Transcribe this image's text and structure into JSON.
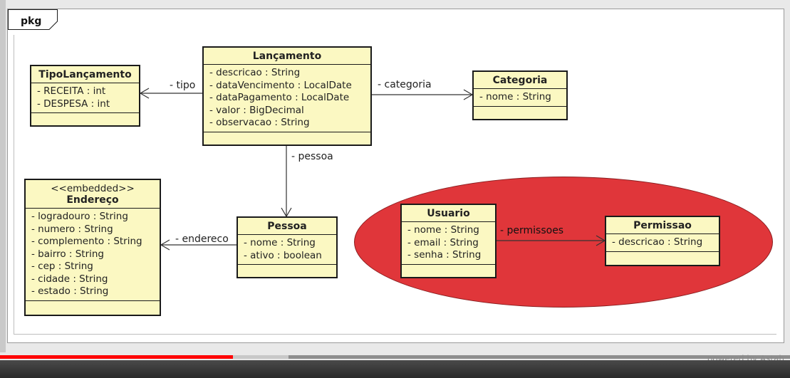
{
  "package": {
    "label": "pkg"
  },
  "classes": {
    "lancamento": {
      "name": "Lançamento",
      "attributes": [
        "- descricao : String",
        "- dataVencimento : LocalDate",
        "- dataPagamento : LocalDate",
        "- valor : BigDecimal",
        "- observacao : String"
      ]
    },
    "tipo_lancamento": {
      "name": "TipoLançamento",
      "attributes": [
        "- RECEITA : int",
        "- DESPESA : int"
      ]
    },
    "categoria": {
      "name": "Categoria",
      "attributes": [
        "- nome : String"
      ]
    },
    "endereco": {
      "stereotype": "<<embedded>>",
      "name": "Endereço",
      "attributes": [
        "- logradouro : String",
        "- numero : String",
        "- complemento : String",
        "- bairro : String",
        "- cep : String",
        "- cidade : String",
        "- estado : String"
      ]
    },
    "pessoa": {
      "name": "Pessoa",
      "attributes": [
        "- nome : String",
        "- ativo : boolean"
      ]
    },
    "usuario": {
      "name": "Usuario",
      "attributes": [
        "- nome : String",
        "- email : String",
        "- senha : String"
      ]
    },
    "permissao": {
      "name": "Permissao",
      "attributes": [
        "- descricao : String"
      ]
    }
  },
  "associations": {
    "tipo": "- tipo",
    "categoria": "- categoria",
    "pessoa": "- pessoa",
    "endereco": "- endereco",
    "permissoes": "- permissoes"
  },
  "highlight": {
    "fill": "#e0363a"
  },
  "video": {
    "progress": 0.295,
    "buffered": 0.07
  },
  "watermark": "powered by Astah"
}
